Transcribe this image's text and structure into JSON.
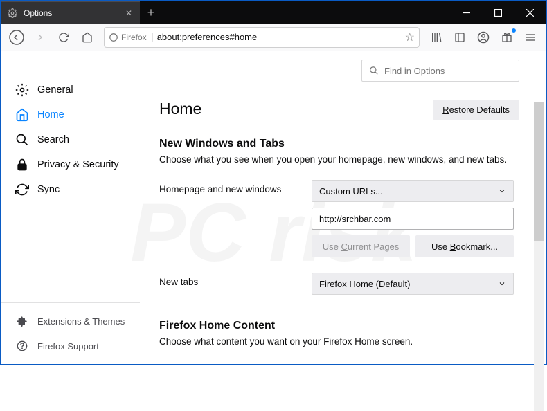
{
  "window": {
    "tab_title": "Options",
    "url": "about:preferences#home",
    "identity_label": "Firefox"
  },
  "find": {
    "placeholder": "Find in Options"
  },
  "sidebar": {
    "items": [
      {
        "label": "General"
      },
      {
        "label": "Home"
      },
      {
        "label": "Search"
      },
      {
        "label": "Privacy & Security"
      },
      {
        "label": "Sync"
      }
    ],
    "bottom": [
      {
        "label": "Extensions & Themes"
      },
      {
        "label": "Firefox Support"
      }
    ]
  },
  "page": {
    "title": "Home",
    "restore": "Restore Defaults",
    "section1": {
      "heading": "New Windows and Tabs",
      "desc": "Choose what you see when you open your homepage, new windows, and new tabs."
    },
    "homepage": {
      "label": "Homepage and new windows",
      "dropdown": "Custom URLs...",
      "url_value": "http://srchbar.com",
      "use_current": "Use Current Pages",
      "use_bookmark": "Use Bookmark..."
    },
    "newtabs": {
      "label": "New tabs",
      "dropdown": "Firefox Home (Default)"
    },
    "section2": {
      "heading": "Firefox Home Content",
      "desc": "Choose what content you want on your Firefox Home screen."
    }
  }
}
